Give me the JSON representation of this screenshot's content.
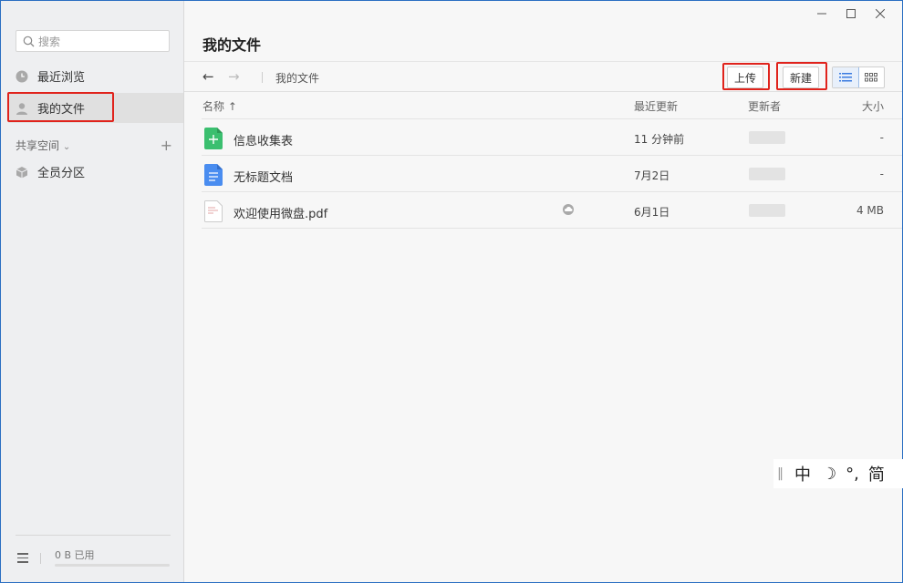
{
  "search": {
    "placeholder": "搜索"
  },
  "sidebar": {
    "recent": "最近浏览",
    "my_files": "我的文件",
    "shared_header": "共享空间",
    "everyone": "全员分区",
    "usage": "0 B 已用"
  },
  "page": {
    "title": "我的文件"
  },
  "toolbar": {
    "breadcrumb": "我的文件",
    "upload": "上传",
    "new": "新建"
  },
  "table": {
    "headers": {
      "name": "名称 ↑",
      "updated": "最近更新",
      "updater": "更新者",
      "size": "大小"
    },
    "rows": [
      {
        "name": "信息收集表",
        "updated": "11 分钟前",
        "size": "-",
        "icon": "sheet-icon",
        "color": "#3bbf6f"
      },
      {
        "name": "无标题文档",
        "updated": "7月2日",
        "size": "-",
        "icon": "doc-icon",
        "color": "#4a8df0"
      },
      {
        "name": "欢迎使用微盘.pdf",
        "updated": "6月1日",
        "size": "4 MB",
        "icon": "pdf-icon",
        "color": "#ffffff"
      }
    ]
  },
  "ime": {
    "lang": "中",
    "moon": "☽",
    "punct": "°,",
    "mode": "简"
  }
}
